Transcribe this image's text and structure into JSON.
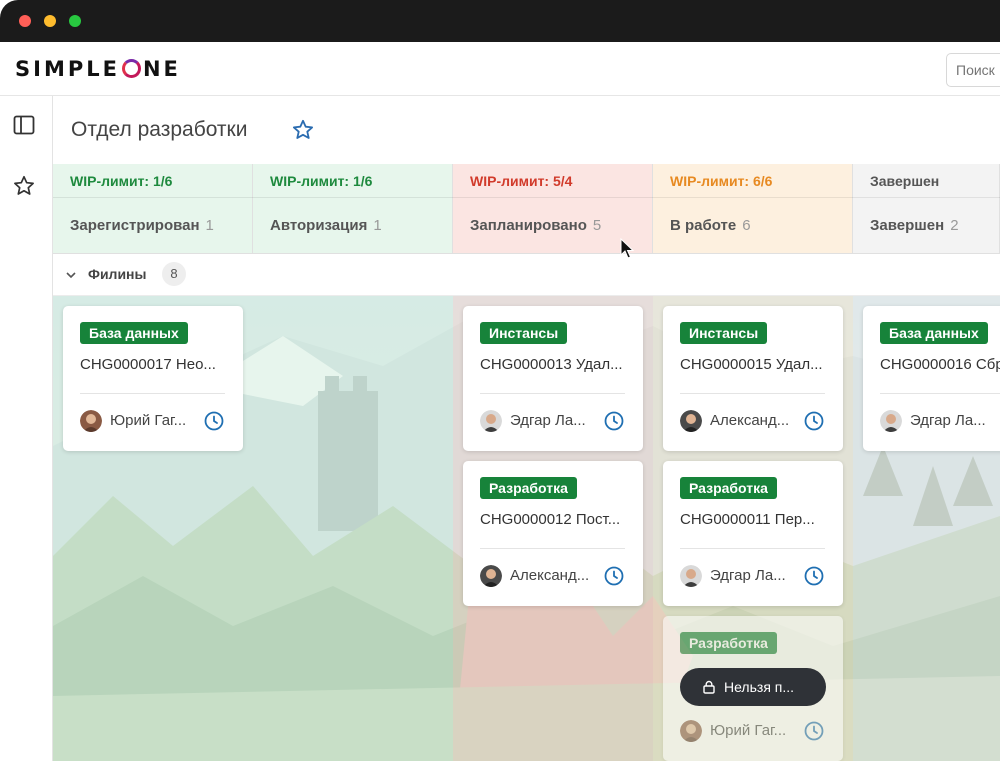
{
  "app": {
    "logo_text_left": "SIMPLE",
    "logo_text_right": "NE",
    "search_placeholder": "Поиск"
  },
  "nav": {
    "icons": [
      "sidebar-toggle-icon",
      "star-icon"
    ]
  },
  "page": {
    "title": "Отдел разработки"
  },
  "columns": [
    {
      "wip": "WIP-лимит: 1/6",
      "name": "Зарегистрирован",
      "count": "1",
      "wip_color": "#1e8a3e",
      "bg": "#e7f6ec"
    },
    {
      "wip": "WIP-лимит: 1/6",
      "name": "Авторизация",
      "count": "1",
      "wip_color": "#1e8a3e",
      "bg": "#e7f6ec"
    },
    {
      "wip": "WIP-лимит: 5/4",
      "name": "Запланировано",
      "count": "5",
      "wip_color": "#d13b2b",
      "bg": "#fbe5e2"
    },
    {
      "wip": "WIP-лимит: 6/6",
      "name": "В работе",
      "count": "6",
      "wip_color": "#e78a22",
      "bg": "#fdf0df"
    },
    {
      "wip": "Завершен",
      "name": "Завершен",
      "count": "2",
      "wip_color": "#555555",
      "bg": "#f3f3f3"
    }
  ],
  "lane": {
    "name": "Филины",
    "count": "8"
  },
  "cards": [
    {
      "tag": "База данных",
      "id": "CHG0000017 Нео...",
      "assignee": "Юрий Гаг..."
    },
    {
      "tag": "Инстансы",
      "id": "CHG0000013 Удал...",
      "assignee": "Эдгар Ла..."
    },
    {
      "tag": "Разработка",
      "id": "CHG0000012 Пост...",
      "assignee": "Александ..."
    },
    {
      "tag": "Инстансы",
      "id": "CHG0000015 Удал...",
      "assignee": "Александ..."
    },
    {
      "tag": "Разработка",
      "id": "CHG0000011 Пер...",
      "assignee": "Эдгар Ла..."
    },
    {
      "tag": "Разработка",
      "id": "",
      "assignee": "Юрий Гаг..."
    },
    {
      "tag": "База данных",
      "id": "CHG0000016 Сбр...",
      "assignee": "Эдгар Ла..."
    }
  ],
  "toast": {
    "text": "Нельзя п..."
  },
  "colors": {
    "tag_green": "#17833a",
    "clock_blue": "#1f6fb2",
    "toast_bg": "#2f3237"
  }
}
